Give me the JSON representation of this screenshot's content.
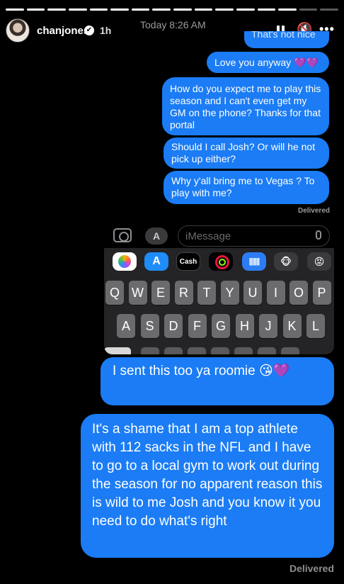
{
  "story": {
    "progress": {
      "segments": 16,
      "viewed": 14
    },
    "username": "chanjones",
    "verified_mark": "✔",
    "time_ago": "1h",
    "controls": {
      "pause_icon": "pause-icon",
      "mute_icon": "mute-icon",
      "more_icon": "more-icon",
      "mute_glyph": "🔇",
      "more_glyph": "•••"
    }
  },
  "screenshot": {
    "timestamp": "Today 8:26 AM",
    "cutoff_message": "That's not nice",
    "messages": [
      "Love you anyway 💜💜",
      "How do you expect me to play this season and I can't even get my GM on the phone? Thanks for that portal",
      "Should I call Josh? Or will he not pick up either?",
      "Why y'all bring me to Vegas ? To play with me?"
    ],
    "delivered": "Delivered",
    "input": {
      "placeholder": "iMessage"
    },
    "appstore_glyph": "A",
    "apps": {
      "cash": "Cash",
      "audio": "|||||||",
      "memoji": "🐵",
      "sticker": "😡"
    },
    "keyboard": {
      "row1": [
        "Q",
        "W",
        "E",
        "R",
        "T",
        "Y",
        "U",
        "I",
        "O",
        "P"
      ],
      "row2": [
        "A",
        "S",
        "D",
        "F",
        "G",
        "H",
        "J",
        "K",
        "L"
      ]
    }
  },
  "overlay": {
    "messages": [
      "I sent this too ya roomie 😘💜",
      "It's a shame that I am a top athlete with 112 sacks in the NFL and I have to go to a local gym to work out during the season for no apparent reason this is wild to me Josh and you know it you need to do what's right"
    ],
    "delivered": "Delivered"
  },
  "colors": {
    "bubble": "#1b7cf5",
    "background": "#000000"
  }
}
